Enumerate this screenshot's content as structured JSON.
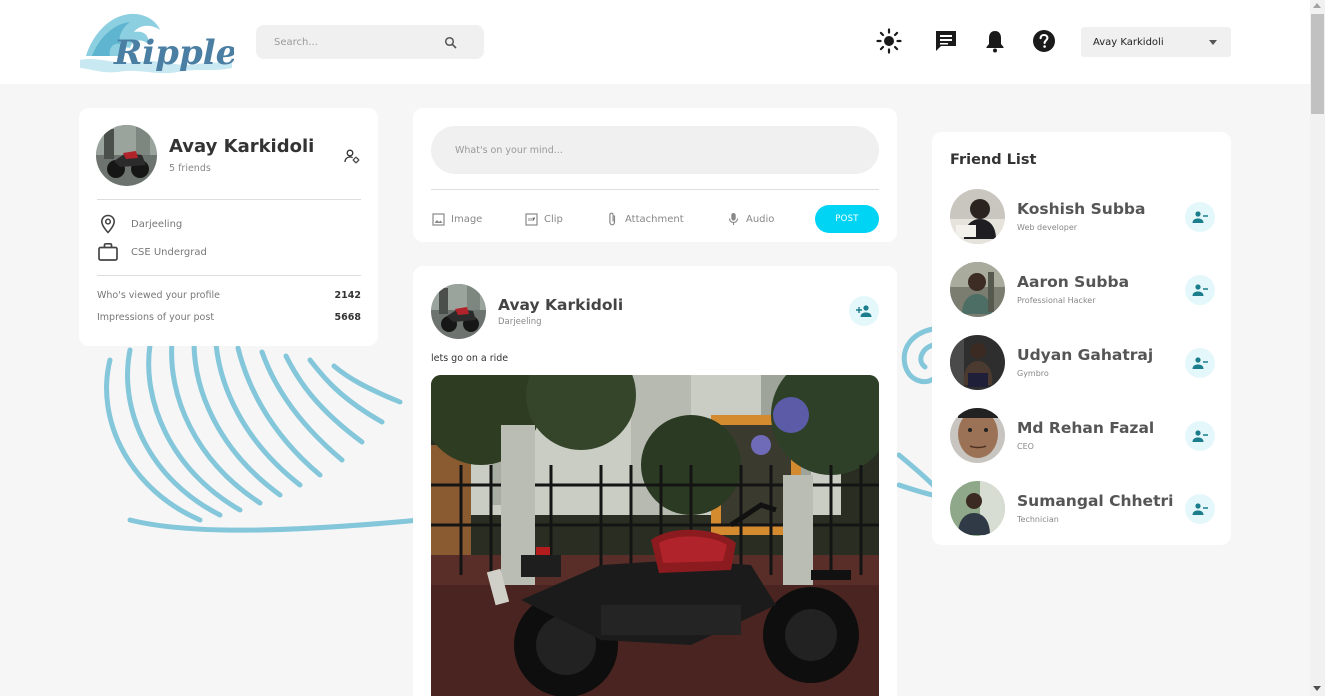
{
  "brand": {
    "logo_text": "Ripple",
    "accent": "#00d4f5",
    "logo_color": "#4a7fa3"
  },
  "search": {
    "placeholder": "Search..."
  },
  "header": {
    "icons": [
      "sun-icon",
      "chat-icon",
      "bell-icon",
      "help-icon"
    ],
    "user_select": "Avay Karkidoli"
  },
  "profile": {
    "name": "Avay Karkidoli",
    "friends": "5 friends",
    "location": "Darjeeling",
    "occupation": "CSE Undergrad",
    "stats": [
      {
        "label": "Who's viewed your profile",
        "value": "2142"
      },
      {
        "label": "Impressions of your post",
        "value": "5668"
      }
    ]
  },
  "composer": {
    "placeholder": "What's on your mind...",
    "tools": {
      "image": "Image",
      "clip": "Clip",
      "attachment": "Attachment",
      "audio": "Audio"
    },
    "post_label": "POST"
  },
  "post": {
    "author": "Avay Karkidoli",
    "location": "Darjeeling",
    "text": "lets go on a ride"
  },
  "friends_list": {
    "title": "Friend List",
    "items": [
      {
        "name": "Koshish Subba",
        "role": "Web developer"
      },
      {
        "name": "Aaron Subba",
        "role": "Professional Hacker"
      },
      {
        "name": "Udyan Gahatraj",
        "role": "Gymbro"
      },
      {
        "name": "Md Rehan Fazal",
        "role": "CEO"
      },
      {
        "name": "Sumangal Chhetri",
        "role": "Technician"
      }
    ]
  }
}
